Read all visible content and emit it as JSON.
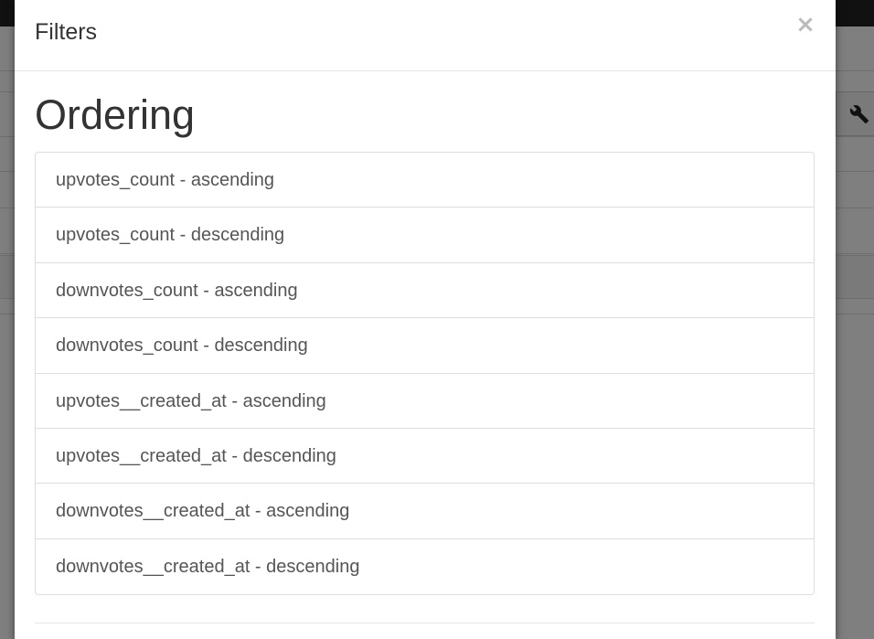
{
  "modal": {
    "title": "Filters",
    "close_symbol": "×",
    "close_icon": "close-icon",
    "section_heading": "Ordering",
    "ordering_options": [
      "upvotes_count - ascending",
      "upvotes_count - descending",
      "downvotes_count - ascending",
      "downvotes_count - descending",
      "upvotes__created_at - ascending",
      "upvotes__created_at - descending",
      "downvotes__created_at - ascending",
      "downvotes__created_at - descending"
    ]
  },
  "background": {
    "tool_icon": "wrench-icon"
  },
  "colors": {
    "topbar": "#222222",
    "text": "#333333",
    "list_text": "#555555",
    "border": "#dddddd",
    "close": "#bbbbbb"
  }
}
